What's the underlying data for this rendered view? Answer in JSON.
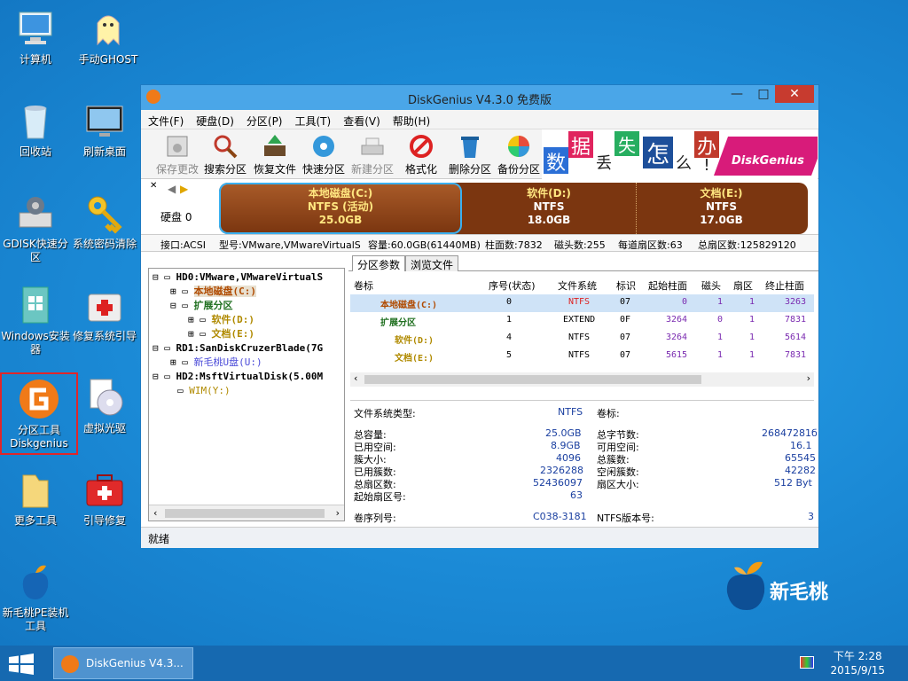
{
  "desktop": {
    "icons": [
      {
        "label": "计算机"
      },
      {
        "label": "手动GHOST"
      },
      {
        "label": "回收站"
      },
      {
        "label": "刷新桌面"
      },
      {
        "label": "GDISK快速分区"
      },
      {
        "label": "系统密码清除"
      },
      {
        "label": "Windows安装器"
      },
      {
        "label": "修复系统引导"
      },
      {
        "label": "分区工具Diskgenius"
      },
      {
        "label": "虚拟光驱"
      },
      {
        "label": "更多工具"
      },
      {
        "label": "引导修复"
      },
      {
        "label": "新毛桃PE装机工具"
      }
    ],
    "watermark": "新毛桃"
  },
  "window": {
    "title": "DiskGenius V4.3.0 免费版",
    "menu": [
      "文件(F)",
      "硬盘(D)",
      "分区(P)",
      "工具(T)",
      "查看(V)",
      "帮助(H)"
    ],
    "toolbar": [
      "保存更改",
      "搜索分区",
      "恢复文件",
      "快速分区",
      "新建分区",
      "格式化",
      "删除分区",
      "备份分区"
    ],
    "banner": {
      "chars": [
        "数",
        "据",
        "丢",
        "失",
        "怎",
        "么",
        "办",
        "!"
      ],
      "brand": "DiskGenius"
    },
    "disk_label": "硬盘 0",
    "partitions": [
      {
        "name": "本地磁盘(C:)",
        "fs": "NTFS (活动)",
        "size": "25.0GB"
      },
      {
        "name": "软件(D:)",
        "fs": "NTFS",
        "size": "18.0GB"
      },
      {
        "name": "文档(E:)",
        "fs": "NTFS",
        "size": "17.0GB"
      }
    ],
    "disk_info": {
      "iface": "接口:ACSI",
      "model": "型号:VMware,VMwareVirtualS",
      "capacity": "容量:60.0GB(61440MB)",
      "cyl": "柱面数:7832",
      "heads": "磁头数:255",
      "spt": "每道扇区数:63",
      "sectors": "总扇区数:125829120"
    },
    "tree": [
      {
        "text": "HD0:VMware,VMwareVirtualS"
      },
      {
        "text": "本地磁盘(C:)"
      },
      {
        "text": "扩展分区"
      },
      {
        "text": "软件(D:)"
      },
      {
        "text": "文档(E:)"
      },
      {
        "text": "RD1:SanDiskCruzerBlade(7G"
      },
      {
        "text": "新毛桃U盘(U:)"
      },
      {
        "text": "HD2:MsftVirtualDisk(5.00M"
      },
      {
        "text": "WIM(Y:)"
      }
    ],
    "tabs": [
      "分区参数",
      "浏览文件"
    ],
    "table": {
      "headers": [
        "卷标",
        "序号(状态)",
        "文件系统",
        "标识",
        "起始柱面",
        "磁头",
        "扇区",
        "终止柱面"
      ],
      "rows": [
        {
          "label": "本地磁盘(C:)",
          "no": "0",
          "fs": "NTFS",
          "id": "07",
          "start": "0",
          "head": "1",
          "sec": "1",
          "end": "3263"
        },
        {
          "label": "扩展分区",
          "no": "1",
          "fs": "EXTEND",
          "id": "0F",
          "start": "3264",
          "head": "0",
          "sec": "1",
          "end": "7831"
        },
        {
          "label": "软件(D:)",
          "no": "4",
          "fs": "NTFS",
          "id": "07",
          "start": "3264",
          "head": "1",
          "sec": "1",
          "end": "5614"
        },
        {
          "label": "文档(E:)",
          "no": "5",
          "fs": "NTFS",
          "id": "07",
          "start": "5615",
          "head": "1",
          "sec": "1",
          "end": "7831"
        }
      ]
    },
    "fsinfo": {
      "fs_type_label": "文件系统类型:",
      "fs_type": "NTFS",
      "vol_label": "卷标:",
      "left": [
        {
          "k": "总容量:",
          "v": "25.0GB"
        },
        {
          "k": "已用空间:",
          "v": "8.9GB"
        },
        {
          "k": "簇大小:",
          "v": "4096"
        },
        {
          "k": "已用簇数:",
          "v": "2326288"
        },
        {
          "k": "总扇区数:",
          "v": "52436097"
        },
        {
          "k": "起始扇区号:",
          "v": "63"
        }
      ],
      "right": [
        {
          "k": "总字节数:",
          "v": "26847281б"
        },
        {
          "k": "可用空间:",
          "v": "16.1"
        },
        {
          "k": "总簇数:",
          "v": "65545"
        },
        {
          "k": "空闲簇数:",
          "v": "42282"
        },
        {
          "k": "扇区大小:",
          "v": "512 Byt"
        }
      ],
      "serial_label": "卷序列号:",
      "serial": "C038-3181",
      "ntfs_ver_label": "NTFS版本号:",
      "ntfs_ver": "3"
    },
    "status": "就绪"
  },
  "taskbar": {
    "item": "DiskGenius V4.3...",
    "time": "下午 2:28",
    "date": "2015/9/15"
  },
  "colors": {
    "accent": "#1f8fd8",
    "partition": "#8b3a0f",
    "title": "#4aa6e8"
  }
}
